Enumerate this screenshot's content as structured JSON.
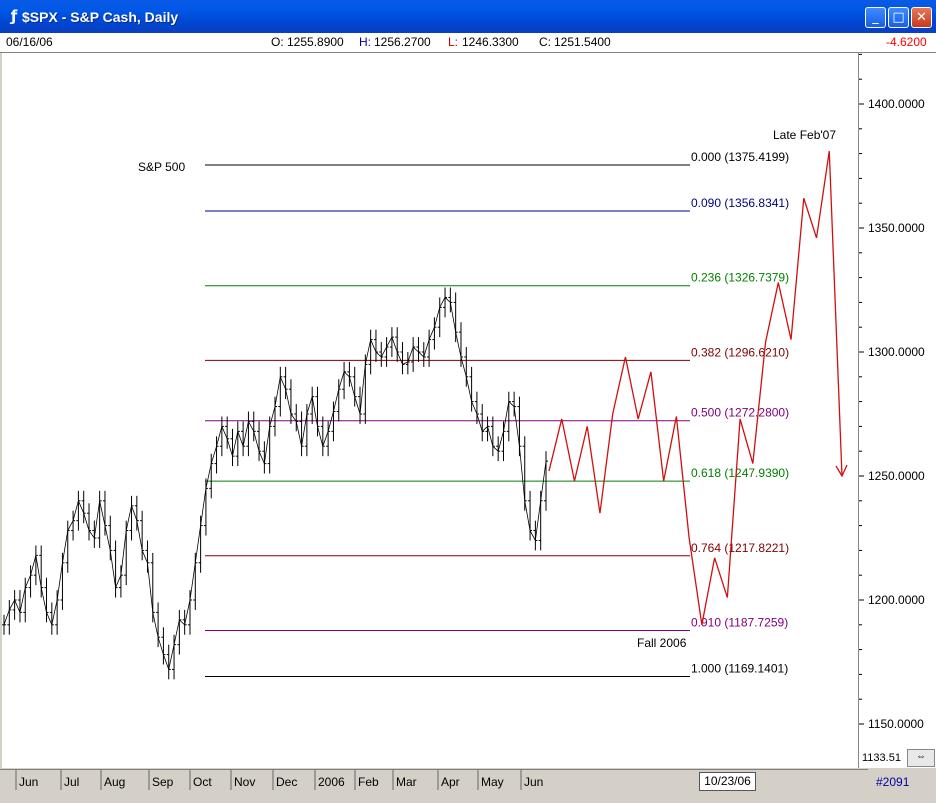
{
  "window": {
    "title": "$SPX - S&P Cash, Daily",
    "icon": "chart-app-icon"
  },
  "quote": {
    "date": "06/16/06",
    "open_label": "O:",
    "open": "1255.8900",
    "high_label": "H:",
    "high": "1256.2700",
    "low_label": "L:",
    "low": "1246.3300",
    "close_label": "C:",
    "close": "1251.5400",
    "change": "-4.6200"
  },
  "status": {
    "cursor_date": "10/23/06",
    "bar_count": "#2091",
    "last_price": "1133.51"
  },
  "chart_data": {
    "type": "line",
    "title": "",
    "annotations": [
      "S&P 500",
      "Late Feb'07",
      "Fall 2006"
    ],
    "ylim": [
      1135,
      1455
    ],
    "y_ticks": [
      "1400.0000",
      "1350.0000",
      "1300.0000",
      "1250.0000",
      "1200.0000",
      "1150.0000"
    ],
    "y_tick_values": [
      1400,
      1350,
      1300,
      1250,
      1200,
      1150
    ],
    "x_ticks": [
      "Jun",
      "Jul",
      "Aug",
      "Sep",
      "Oct",
      "Nov",
      "Dec",
      "2006",
      "Feb",
      "Mar",
      "Apr",
      "May",
      "Jun"
    ],
    "fib_levels": [
      {
        "label": "0.000 (1375.4199)",
        "value": 1375.4199,
        "color": "#000000"
      },
      {
        "label": "0.090 (1356.8341)",
        "value": 1356.8341,
        "color": "#000080"
      },
      {
        "label": "0.236 (1326.7379)",
        "value": 1326.7379,
        "color": "#008000"
      },
      {
        "label": "0.382 (1296.6210)",
        "value": 1296.621,
        "color": "#800000"
      },
      {
        "label": "0.500 (1272.2800)",
        "value": 1272.28,
        "color": "#800080"
      },
      {
        "label": "0.618 (1247.9390)",
        "value": 1247.939,
        "color": "#008000"
      },
      {
        "label": "0.764 (1217.8221)",
        "value": 1217.8221,
        "color": "#800000"
      },
      {
        "label": "0.910 (1187.7259)",
        "value": 1187.7259,
        "color": "#800080"
      },
      {
        "label": "1.000 (1169.1401)",
        "value": 1169.1401,
        "color": "#000000"
      }
    ],
    "series": [
      {
        "kind": "price",
        "color": "#000000",
        "values": [
          1190,
          1196,
          1200,
          1195,
          1205,
          1210,
          1218,
          1205,
          1195,
          1190,
          1200,
          1215,
          1228,
          1232,
          1240,
          1235,
          1228,
          1225,
          1240,
          1230,
          1220,
          1205,
          1210,
          1228,
          1238,
          1232,
          1220,
          1215,
          1195,
          1185,
          1178,
          1172,
          1182,
          1192,
          1190,
          1200,
          1215,
          1230,
          1245,
          1255,
          1262,
          1270,
          1265,
          1258,
          1268,
          1262,
          1272,
          1268,
          1260,
          1255,
          1270,
          1278,
          1290,
          1285,
          1275,
          1272,
          1262,
          1275,
          1282,
          1270,
          1262,
          1268,
          1276,
          1285,
          1292,
          1290,
          1282,
          1275,
          1295,
          1305,
          1300,
          1298,
          1302,
          1306,
          1300,
          1295,
          1296,
          1302,
          1300,
          1298,
          1305,
          1310,
          1318,
          1322,
          1320,
          1308,
          1298,
          1290,
          1280,
          1275,
          1268,
          1270,
          1262,
          1260,
          1268,
          1280,
          1278,
          1262,
          1240,
          1228,
          1224,
          1240,
          1256
        ]
      },
      {
        "kind": "projection",
        "color": "#d01010",
        "values": [
          1252,
          1273,
          1248,
          1270,
          1235,
          1275,
          1298,
          1273,
          1292,
          1248,
          1274,
          1225,
          1190,
          1217,
          1201,
          1273,
          1255,
          1304,
          1328,
          1305,
          1362,
          1346,
          1381,
          1250
        ]
      }
    ]
  }
}
